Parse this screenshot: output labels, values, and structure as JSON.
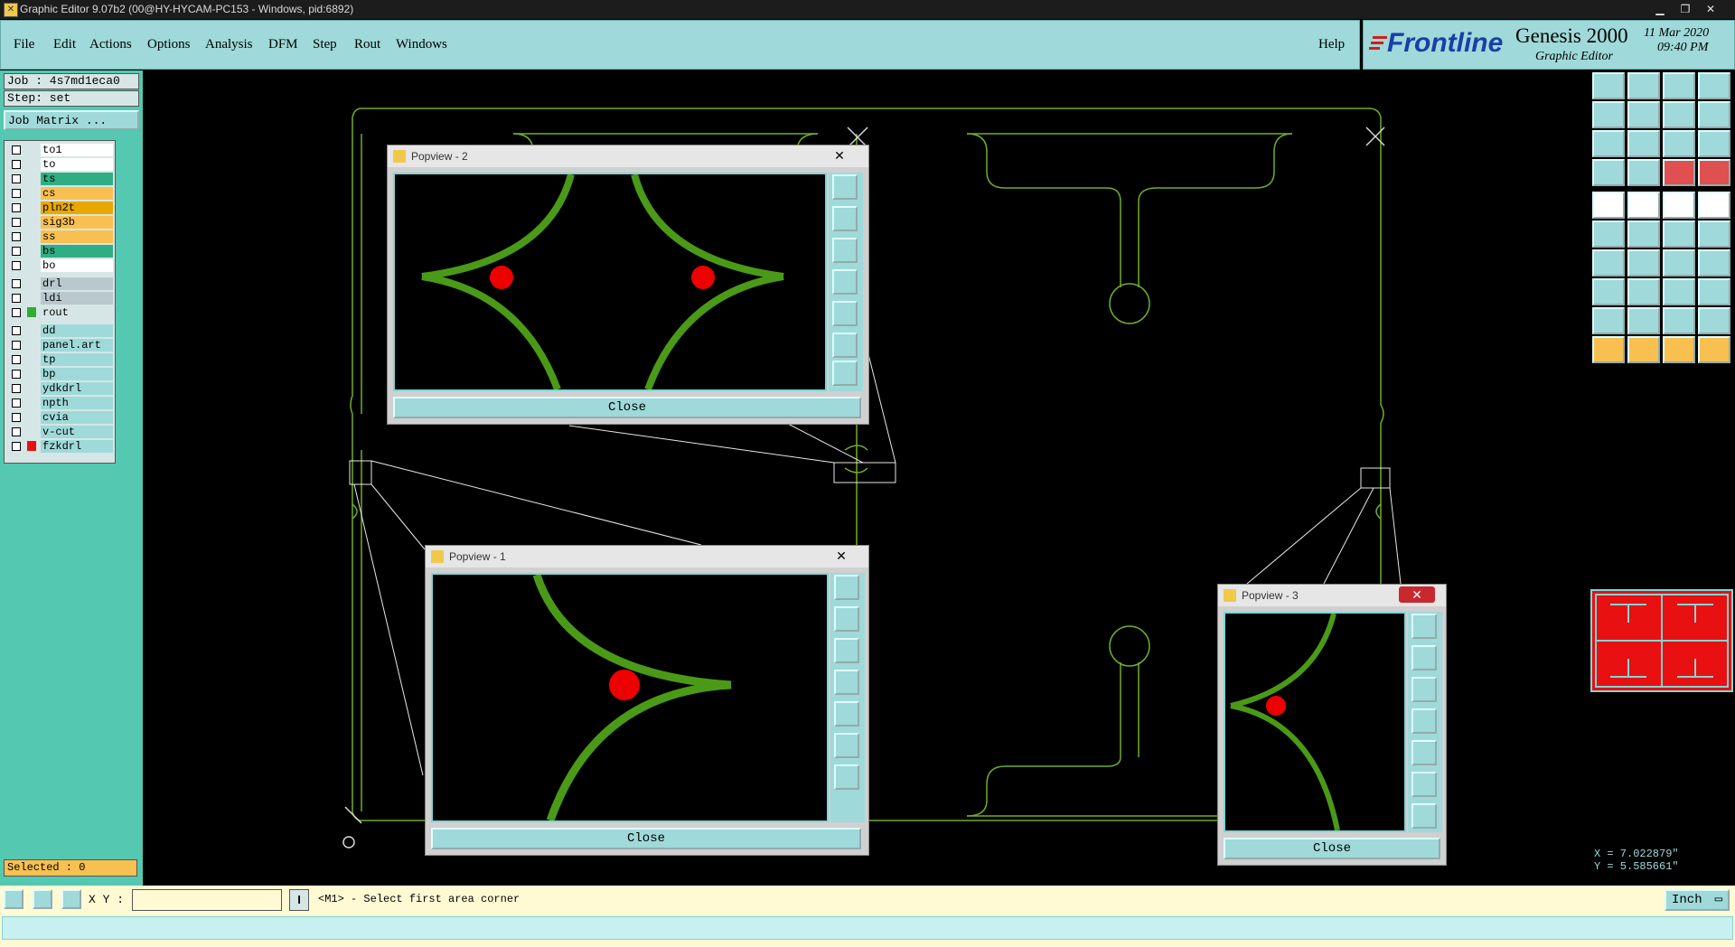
{
  "window": {
    "title": "Graphic Editor 9.07b2 (00@HY-HYCAM-PC153 - Windows, pid:6892)"
  },
  "menu": {
    "items": [
      "File",
      "Edit",
      "Actions",
      "Options",
      "Analysis",
      "DFM",
      "Step",
      "Rout",
      "Windows"
    ],
    "help": "Help"
  },
  "brand": {
    "logo": "Frontline",
    "product": "Genesis 2000",
    "subtitle": "Graphic Editor",
    "date": "11 Mar 2020",
    "time": "09:40 PM"
  },
  "job": {
    "job_label": "Job : 4s7md1eca0",
    "step_label": "Step: set",
    "matrix_button": "Job Matrix ..."
  },
  "layers": [
    {
      "name": "to1",
      "bg": "#ffffff"
    },
    {
      "name": "to",
      "bg": "#ffffff"
    },
    {
      "name": "ts",
      "bg": "#2fae83"
    },
    {
      "name": "cs",
      "bg": "#f8c050"
    },
    {
      "name": "pln2t",
      "bg": "#e8a800"
    },
    {
      "name": "sig3b",
      "bg": "#f8c050"
    },
    {
      "name": "ss",
      "bg": "#f8c050"
    },
    {
      "name": "bs",
      "bg": "#2fae83"
    },
    {
      "name": "bo",
      "bg": "#ffffff"
    },
    {
      "name": "drl",
      "bg": "#b8c8cc"
    },
    {
      "name": "ldi",
      "bg": "#b8c8cc"
    },
    {
      "name": "rout",
      "bg": "#d6e6e6"
    },
    {
      "name": "dd",
      "bg": "#9fd9d9"
    },
    {
      "name": "panel.art",
      "bg": "#9fd9d9"
    },
    {
      "name": "tp",
      "bg": "#9fd9d9"
    },
    {
      "name": "bp",
      "bg": "#9fd9d9"
    },
    {
      "name": "ydkdrl",
      "bg": "#9fd9d9"
    },
    {
      "name": "npth",
      "bg": "#9fd9d9"
    },
    {
      "name": "cvia",
      "bg": "#9fd9d9"
    },
    {
      "name": "v-cut",
      "bg": "#9fd9d9"
    },
    {
      "name": "fzkdrl",
      "bg": "#9fd9d9"
    }
  ],
  "selected": "Selected : 0",
  "popups": [
    {
      "title": "Popview - 2",
      "close": "Close"
    },
    {
      "title": "Popview - 1",
      "close": "Close"
    },
    {
      "title": "Popview - 3",
      "close": "Close"
    }
  ],
  "coords": {
    "x": "X = 7.022879\"",
    "y": "Y = 5.585661\""
  },
  "status": {
    "xy_label": "X Y :",
    "xy_value": "",
    "prompt": "<M1> - Select first area corner",
    "units": "Inch"
  }
}
